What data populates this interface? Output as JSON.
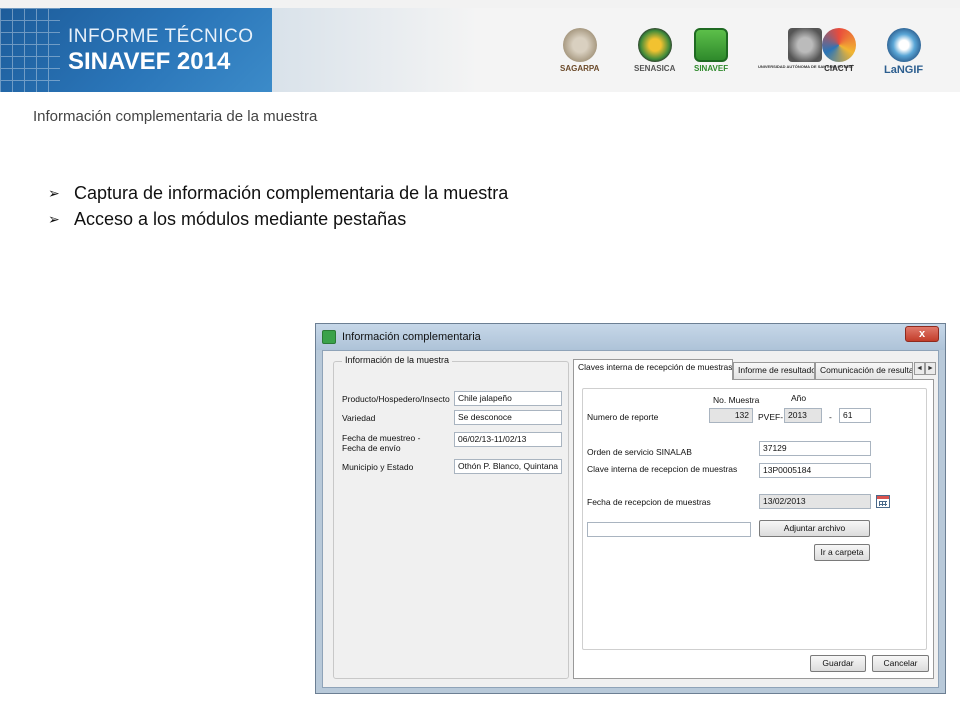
{
  "header": {
    "title_line1": "INFORME TÉCNICO",
    "title_line2": "SINAVEF 2014",
    "logos": [
      {
        "name": "SAGARPA"
      },
      {
        "name": "SENASICA"
      },
      {
        "name": "SINAVEF"
      },
      {
        "name": "UNIVERSIDAD AUTÓNOMA DE SAN LUIS POTOSÍ"
      },
      {
        "name": "CIACYT"
      },
      {
        "name": "LaNGIF"
      }
    ]
  },
  "slide": {
    "subtitle": "Información complementaria de la muestra",
    "bullets": [
      "Captura de información complementaria de la muestra",
      "Acceso a los módulos mediante pestañas"
    ]
  },
  "window": {
    "title": "Información complementaria",
    "close_label": "x",
    "left_group": {
      "legend": "Información de la muestra",
      "fields": [
        {
          "label": "Producto/Hospedero/Insecto",
          "value": "Chile jalapeño"
        },
        {
          "label": "Variedad",
          "value": "Se desconoce"
        },
        {
          "label": "Fecha de muestreo -",
          "label2": "Fecha de envío",
          "value": "06/02/13-11/02/13"
        },
        {
          "label": "Municipio y Estado",
          "value": "Othón P. Blanco, Quintana R"
        }
      ]
    },
    "tabs": [
      {
        "label": "Claves interna de recepción de muestras"
      },
      {
        "label": "Informe de resultado"
      },
      {
        "label": "Comunicación de resultad"
      }
    ],
    "tab_scroll_left": "◄",
    "tab_scroll_right": "►",
    "panel": {
      "no_muestra_header": "No. Muestra",
      "anio_header": "Año",
      "numero_reporte_label": "Numero de reporte",
      "no_muestra_value": "132",
      "pvef_prefix": "PVEF-",
      "anio_value": "2013",
      "dash": "-",
      "seq_value": "61",
      "orden_label": "Orden de servicio SINALAB",
      "orden_value": "37129",
      "clave_label": "Clave interna de recepcion de muestras",
      "clave_value": "13P0005184",
      "fecha_label": "Fecha de recepcion de muestras",
      "fecha_value": "13/02/2013",
      "archivo_value": "",
      "adjuntar_label": "Adjuntar archivo",
      "carpeta_label": "Ir a carpeta",
      "guardar_label": "Guardar",
      "cancelar_label": "Cancelar"
    }
  },
  "colors": {
    "banner_blue": "#2a75b8",
    "window_frame": "#b8c9d9",
    "close_red": "#c23d2a"
  }
}
